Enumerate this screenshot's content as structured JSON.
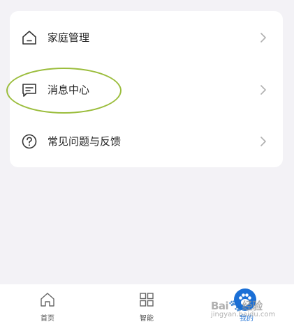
{
  "menu": {
    "items": [
      {
        "label": "家庭管理",
        "icon": "home-icon"
      },
      {
        "label": "消息中心",
        "icon": "message-icon"
      },
      {
        "label": "常见问题与反馈",
        "icon": "help-icon"
      }
    ]
  },
  "tabbar": {
    "tabs": [
      {
        "label": "首页",
        "icon": "home-tab-icon"
      },
      {
        "label": "智能",
        "icon": "grid-icon"
      },
      {
        "label": "我的",
        "icon": "paw-avatar-icon",
        "active": true
      }
    ],
    "active_color": "#1a6fd6"
  },
  "watermark": {
    "brand": "Bai",
    "brand_suffix": "经验",
    "url": "jingyan.baidu.com"
  },
  "highlight_color": "#9bbd3c"
}
